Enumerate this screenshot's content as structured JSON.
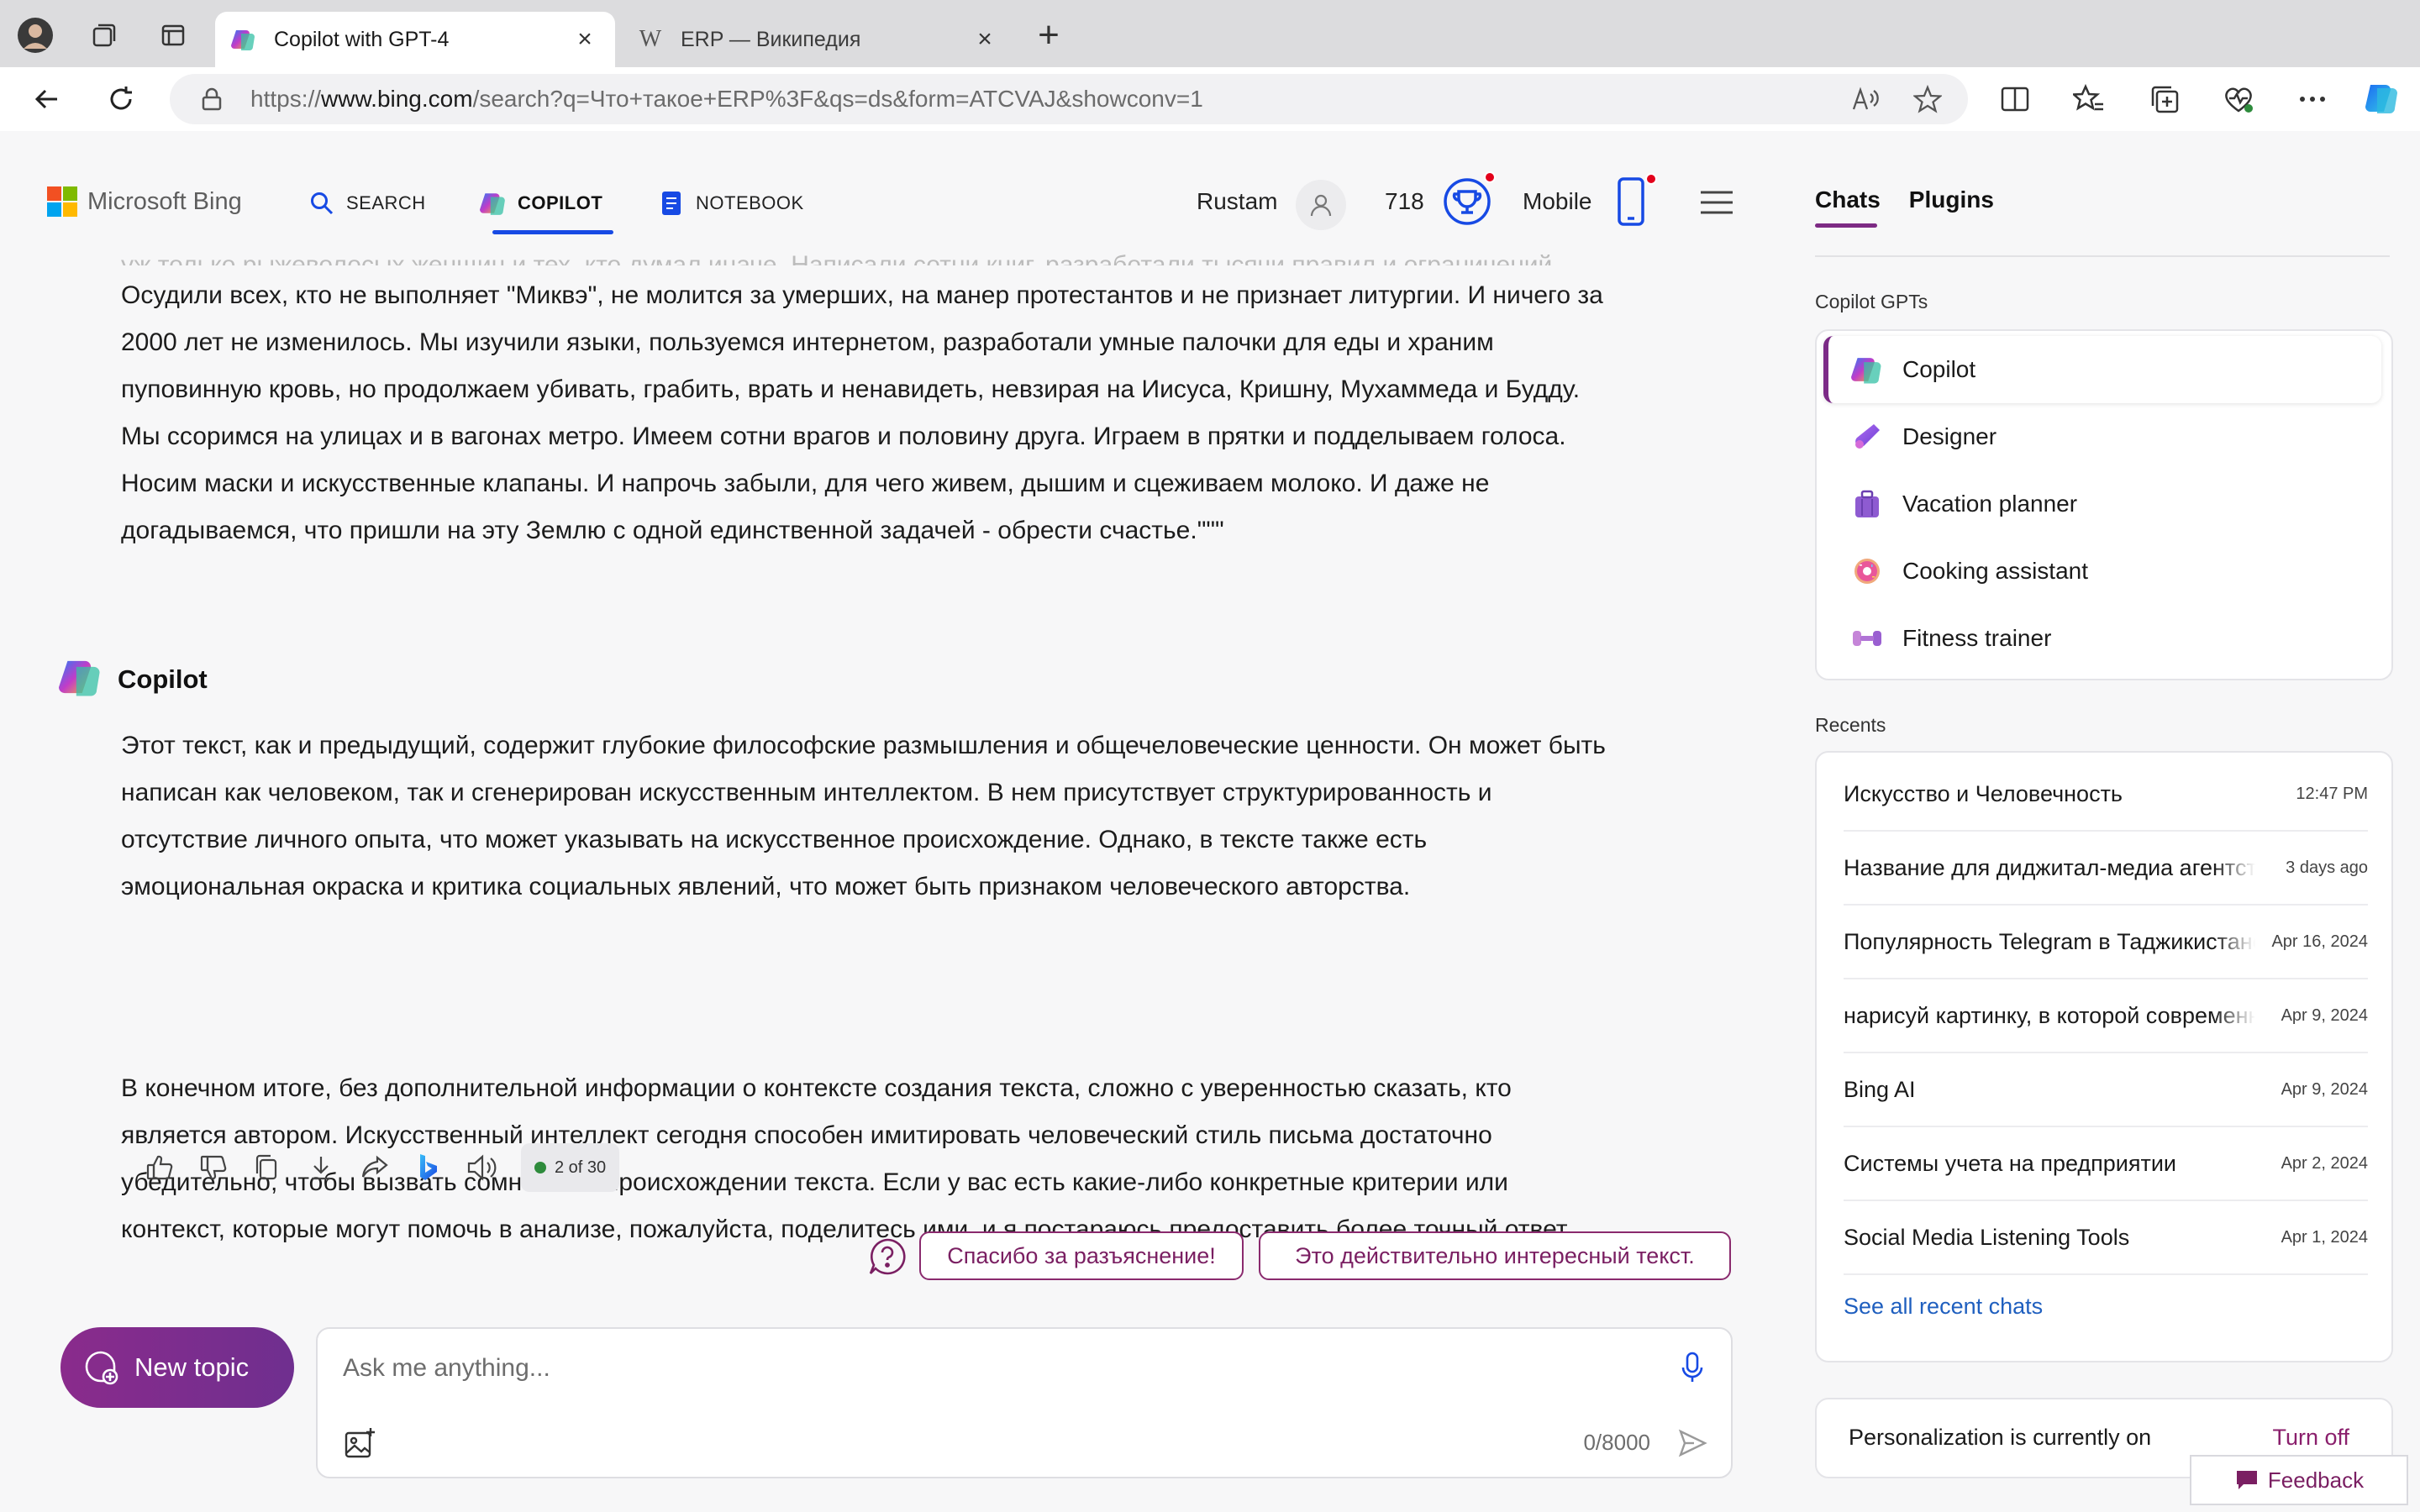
{
  "browser": {
    "tabs": [
      {
        "title": "Copilot with GPT-4",
        "active": true
      },
      {
        "title": "ERP — Википедия",
        "active": false
      }
    ],
    "url": {
      "scheme": "https://",
      "host": "www.bing.com",
      "path": "/search?q=Что+такое+ERP%3F&qs=ds&form=ATCVAJ&showconv=1"
    }
  },
  "header": {
    "logo": "Microsoft Bing",
    "nav": [
      {
        "label": "SEARCH",
        "icon": "search-icon"
      },
      {
        "label": "COPILOT",
        "icon": "copilot-icon",
        "active": true
      },
      {
        "label": "NOTEBOOK",
        "icon": "notebook-icon"
      }
    ],
    "user": "Rustam",
    "points": "718",
    "mobile": "Mobile"
  },
  "conversation": {
    "user_message_tail": "уж только рыжеволосых женщин и тех, кто думал иначе. Написали сотни книг, разработали тысячи правил и ограничений.",
    "user_message_lines": [
      "Осудили всех, кто не выполняет \"Миквэ\", не молится за умерших, на манер протестантов и не признает литургии. И ничего за",
      "2000 лет не изменилось. Мы изучили языки, пользуемся интернетом, разработали умные палочки для еды и храним",
      "пуповинную кровь, но продолжаем убивать, грабить, врать и ненавидеть, невзирая на Иисуса, Кришну, Мухаммеда и Будду.",
      "Мы ссоримся на улицах и в вагонах метро. Имеем сотни врагов и половину друга. Играем в прятки и подделываем голоса.",
      "Носим маски и искусственные клапаны. И напрочь забыли, для чего живем, дышим и сцеживаем молоко. И даже не",
      "догадываемся, что пришли на эту Землю с одной единственной задачей - обрести счастье.\"\"\""
    ],
    "assistant_name": "Copilot",
    "answer_p1": [
      "Этот текст, как и предыдущий, содержит глубокие философские размышления и общечеловеческие ценности. Он может быть",
      "написан как человеком, так и сгенерирован искусственным интеллектом. В нем присутствует структурированность и",
      "отсутствие личного опыта, что может указывать на искусственное происхождение. Однако, в тексте также есть",
      "эмоциональная окраска и критика социальных явлений, что может быть признаком человеческого авторства."
    ],
    "answer_p2": [
      "В конечном итоге, без дополнительной информации о контексте создания текста, сложно с уверенностью сказать, кто",
      "является автором. Искусственный интеллект сегодня способен имитировать человеческий стиль письма достаточно",
      "убедительно, чтобы вызвать сомнения в происхождении текста. Если у вас есть какие-либо конкретные критерии или",
      "контекст, которые могут помочь в анализе, пожалуйста, поделитесь ими, и я постараюсь предоставить более точный ответ."
    ],
    "response_count": "2 of 30",
    "suggestions": [
      "Спасибо за разъяснение!",
      "Это действительно интересный текст."
    ]
  },
  "composer": {
    "new_topic": "New topic",
    "placeholder": "Ask me anything...",
    "char_count": "0/8000"
  },
  "sidebar": {
    "tabs": [
      "Chats",
      "Plugins"
    ],
    "gpts_label": "Copilot GPTs",
    "gpts": [
      {
        "label": "Copilot",
        "icon": "copilot-icon",
        "selected": true
      },
      {
        "label": "Designer",
        "icon": "designer-icon"
      },
      {
        "label": "Vacation planner",
        "icon": "suitcase-icon"
      },
      {
        "label": "Cooking assistant",
        "icon": "donut-icon"
      },
      {
        "label": "Fitness trainer",
        "icon": "dumbbell-icon"
      }
    ],
    "recents_label": "Recents",
    "recents": [
      {
        "title": "Искусство и Человечность",
        "date": "12:47 PM"
      },
      {
        "title": "Название для диджитал-медиа агентства",
        "date": "3 days ago"
      },
      {
        "title": "Популярность Telegram в Таджикистане",
        "date": "Apr 16, 2024"
      },
      {
        "title": "нарисуй картинку, в которой современный",
        "date": "Apr 9, 2024"
      },
      {
        "title": "Bing AI",
        "date": "Apr 9, 2024"
      },
      {
        "title": "Системы учета на предприятии",
        "date": "Apr 2, 2024"
      },
      {
        "title": "Social Media Listening Tools",
        "date": "Apr 1, 2024"
      }
    ],
    "see_all": "See all recent chats",
    "personalization": "Personalization is currently on",
    "turn_off": "Turn off",
    "feedback": "Feedback"
  },
  "colors": {
    "accent_purple": "#7b2a86",
    "nav_underline": "#174ae4",
    "link_blue": "#1f5fbf"
  }
}
